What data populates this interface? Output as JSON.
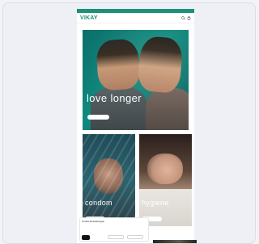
{
  "header": {
    "promo_text": "",
    "brand": "VIKAY",
    "menu": [
      "",
      "",
      "",
      "",
      "",
      ""
    ]
  },
  "hero": {
    "title": "love longer",
    "subtitle": "",
    "cta": ""
  },
  "cards": [
    {
      "title": "condom",
      "cta": ""
    },
    {
      "title": "hygiene",
      "cta": ""
    }
  ],
  "cookie": {
    "title": "Cookie Einstellungen",
    "text": "",
    "accept": "",
    "decline": ""
  },
  "colors": {
    "accent": "#1f8f78",
    "background": "#eef0f6"
  },
  "icons": {
    "search": "search-icon",
    "cart": "cart-icon"
  }
}
